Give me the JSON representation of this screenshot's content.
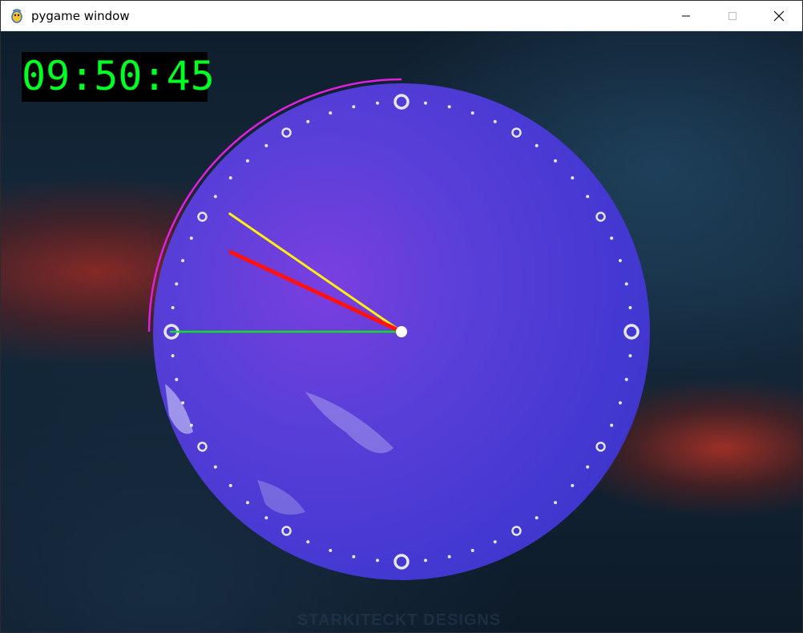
{
  "window": {
    "title": "pygame window",
    "app_icon": "pygame-snake-icon",
    "controls": {
      "minimize_icon": "minimize-icon",
      "maximize_icon": "maximize-icon",
      "close_icon": "close-icon"
    }
  },
  "clock": {
    "digital_time": "09:50:45",
    "hours": 9,
    "minutes": 50,
    "seconds": 45,
    "colors": {
      "digital_text": "#00ff22",
      "hour_hand": "#ff1111",
      "minute_hand": "#ffee11",
      "second_hand": "#11dd22",
      "second_arc": "#e020e0",
      "markers": "#e6e6f0",
      "face": "#4a3fd0"
    }
  },
  "background": {
    "watermark": "STARKITECKT DESIGNS"
  }
}
